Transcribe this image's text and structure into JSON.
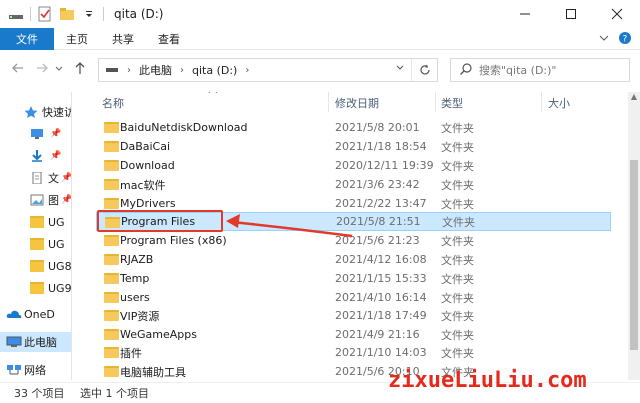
{
  "window": {
    "title": "qita (D:)",
    "controls": [
      "minimize",
      "maximize",
      "close"
    ]
  },
  "ribbon": {
    "tabs": [
      "文件",
      "主页",
      "共享",
      "查看"
    ]
  },
  "address": {
    "crumbs": [
      "此电脑",
      "qita (D:)"
    ],
    "search_placeholder": "搜索\"qita (D:)\""
  },
  "nav": {
    "items": [
      {
        "label": "快速访",
        "icon": "star-icon"
      },
      {
        "label": "",
        "icon": "desktop-icon"
      },
      {
        "label": "",
        "icon": "download-icon"
      },
      {
        "label": "文",
        "icon": "documents-icon"
      },
      {
        "label": "图",
        "icon": "pictures-icon"
      },
      {
        "label": "UG",
        "icon": "folder-icon"
      },
      {
        "label": "UG",
        "icon": "folder-icon"
      },
      {
        "label": "UG8",
        "icon": "folder-icon"
      },
      {
        "label": "UG9",
        "icon": "folder-icon"
      },
      {
        "label": "OneD",
        "icon": "onedrive-icon"
      },
      {
        "label": "此电脑",
        "icon": "this-pc-icon"
      },
      {
        "label": "网络",
        "icon": "network-icon"
      }
    ]
  },
  "columns": {
    "name": "名称",
    "date": "修改日期",
    "type": "类型",
    "size": "大小"
  },
  "files": [
    {
      "name": "BaiduNetdiskDownload",
      "date": "2021/5/8 20:01",
      "type": "文件夹"
    },
    {
      "name": "DaBaiCai",
      "date": "2021/1/18 18:54",
      "type": "文件夹"
    },
    {
      "name": "Download",
      "date": "2020/12/11 19:39",
      "type": "文件夹"
    },
    {
      "name": "mac软件",
      "date": "2021/3/6 23:42",
      "type": "文件夹"
    },
    {
      "name": "MyDrivers",
      "date": "2021/2/22 13:47",
      "type": "文件夹"
    },
    {
      "name": "Program Files",
      "date": "2021/5/8 21:51",
      "type": "文件夹",
      "selected": true
    },
    {
      "name": "Program Files (x86)",
      "date": "2021/5/6 21:23",
      "type": "文件夹"
    },
    {
      "name": "RJAZB",
      "date": "2021/4/12 16:08",
      "type": "文件夹"
    },
    {
      "name": "Temp",
      "date": "2021/1/15 15:33",
      "type": "文件夹"
    },
    {
      "name": "users",
      "date": "2021/4/10 16:14",
      "type": "文件夹"
    },
    {
      "name": "VIP资源",
      "date": "2021/1/18 17:49",
      "type": "文件夹"
    },
    {
      "name": "WeGameApps",
      "date": "2021/4/9 21:16",
      "type": "文件夹"
    },
    {
      "name": "插件",
      "date": "2021/1/10 14:03",
      "type": "文件夹"
    },
    {
      "name": "电脑辅助工具",
      "date": "2021/5/6 20:10",
      "type": "文件夹"
    }
  ],
  "status": {
    "count": "33 个项目",
    "selection": "选中 1 个项目"
  },
  "watermark": "zixueLiuLiu.com",
  "colors": {
    "accent": "#1979ca",
    "selection": "#cce8ff",
    "annotation": "#e23a2a"
  }
}
